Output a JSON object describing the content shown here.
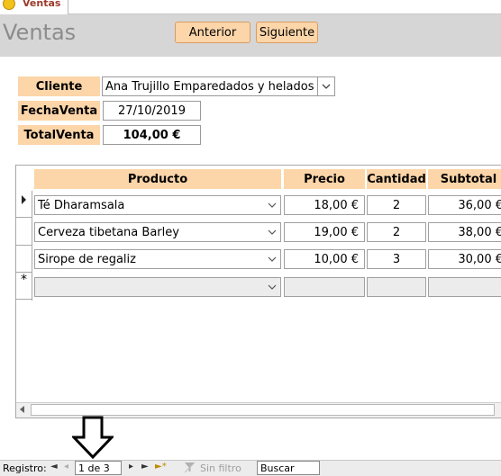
{
  "tab": {
    "label": "Ventas",
    "icon": "smiley-form-icon"
  },
  "header": {
    "title": "Ventas",
    "prev_button": "Anterior",
    "next_button": "Siguiente"
  },
  "fields": {
    "cliente_label": "Cliente",
    "cliente_value": "Ana Trujillo Emparedados y helados",
    "fecha_label": "FechaVenta",
    "fecha_value": "27/10/2019",
    "total_label": "TotalVenta",
    "total_value": "104,00 €"
  },
  "grid": {
    "columns": [
      "Producto",
      "Precio",
      "Cantidad",
      "Subtotal"
    ],
    "rows": [
      {
        "producto": "Té Dharamsala",
        "precio": "18,00 €",
        "cantidad": "2",
        "subtotal": "36,00 €"
      },
      {
        "producto": "Cerveza tibetana Barley",
        "precio": "19,00 €",
        "cantidad": "2",
        "subtotal": "38,00 €"
      },
      {
        "producto": "Sirope de regaliz",
        "precio": "10,00 €",
        "cantidad": "3",
        "subtotal": "30,00 €"
      }
    ],
    "new_row_marker": "*"
  },
  "record_nav": {
    "label": "Registro:",
    "position": "1 de 3",
    "filter_label": "Sin filtro",
    "search_placeholder": "Buscar"
  }
}
